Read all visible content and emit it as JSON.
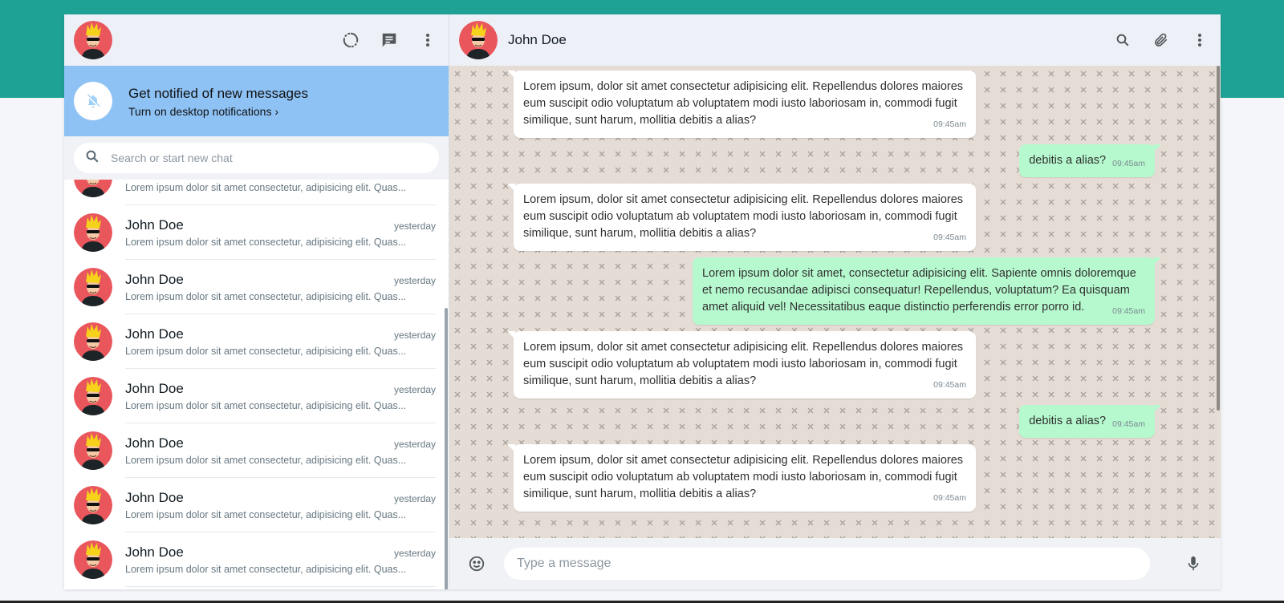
{
  "colors": {
    "band": "#1fa296",
    "header_bg": "#edf0f7",
    "notify_bg": "#8ec2f5",
    "incoming_bubble": "#ffffff",
    "outgoing_bubble": "#b6f9ce",
    "wallpaper": "#e5ddd5"
  },
  "sidebar": {
    "header_icons": [
      "status-icon",
      "new-chat-icon",
      "menu-icon"
    ],
    "notification": {
      "title": "Get notified of new messages",
      "link": "Turn on desktop notifications ›",
      "icon": "bell-off-icon"
    },
    "search": {
      "placeholder": "Search or start new chat"
    },
    "partial_item": {
      "preview": "Lorem ipsum dolor sit amet consectetur, adipisicing elit. Quas..."
    },
    "chats": [
      {
        "name": "John Doe",
        "time": "yesterday",
        "preview": "Lorem ipsum dolor sit amet consectetur, adipisicing elit. Quas..."
      },
      {
        "name": "John Doe",
        "time": "yesterday",
        "preview": "Lorem ipsum dolor sit amet consectetur, adipisicing elit. Quas..."
      },
      {
        "name": "John Doe",
        "time": "yesterday",
        "preview": "Lorem ipsum dolor sit amet consectetur, adipisicing elit. Quas..."
      },
      {
        "name": "John Doe",
        "time": "yesterday",
        "preview": "Lorem ipsum dolor sit amet consectetur, adipisicing elit. Quas..."
      },
      {
        "name": "John Doe",
        "time": "yesterday",
        "preview": "Lorem ipsum dolor sit amet consectetur, adipisicing elit. Quas..."
      },
      {
        "name": "John Doe",
        "time": "yesterday",
        "preview": "Lorem ipsum dolor sit amet consectetur, adipisicing elit. Quas..."
      },
      {
        "name": "John Doe",
        "time": "yesterday",
        "preview": "Lorem ipsum dolor sit amet consectetur, adipisicing elit. Quas..."
      }
    ]
  },
  "conversation": {
    "contact_name": "John Doe",
    "header_icons": [
      "search-icon",
      "attach-icon",
      "menu-icon"
    ],
    "messages": [
      {
        "dir": "in",
        "text": "Lorem ipsum, dolor sit amet consectetur adipisicing elit. Repellendus dolores maiores eum suscipit odio voluptatum ab voluptatem modi iusto laboriosam in, commodi fugit similique, sunt harum, mollitia debitis a alias?",
        "time": "09:45am"
      },
      {
        "dir": "out",
        "short": true,
        "text": "debitis a alias?",
        "time": "09:45am"
      },
      {
        "dir": "in",
        "text": "Lorem ipsum, dolor sit amet consectetur adipisicing elit. Repellendus dolores maiores eum suscipit odio voluptatum ab voluptatem modi iusto laboriosam in, commodi fugit similique, sunt harum, mollitia debitis a alias?",
        "time": "09:45am"
      },
      {
        "dir": "out",
        "text": "Lorem ipsum dolor sit amet, consectetur adipisicing elit. Sapiente omnis doloremque et nemo recusandae adipisci consequatur! Repellendus, voluptatum? Ea quisquam amet aliquid vel! Necessitatibus eaque distinctio perferendis error porro id.",
        "time": "09:45am"
      },
      {
        "dir": "in",
        "text": "Lorem ipsum, dolor sit amet consectetur adipisicing elit. Repellendus dolores maiores eum suscipit odio voluptatum ab voluptatem modi iusto laboriosam in, commodi fugit similique, sunt harum, mollitia debitis a alias?",
        "time": "09:45am"
      },
      {
        "dir": "out",
        "short": true,
        "text": "debitis a alias?",
        "time": "09:45am"
      },
      {
        "dir": "in",
        "text": "Lorem ipsum, dolor sit amet consectetur adipisicing elit. Repellendus dolores maiores eum suscipit odio voluptatum ab voluptatem modi iusto laboriosam in, commodi fugit similique, sunt harum, mollitia debitis a alias?",
        "time": "09:45am"
      }
    ],
    "composer": {
      "placeholder": "Type a message",
      "emoji_icon": "emoji-icon",
      "mic_icon": "microphone-icon"
    }
  }
}
